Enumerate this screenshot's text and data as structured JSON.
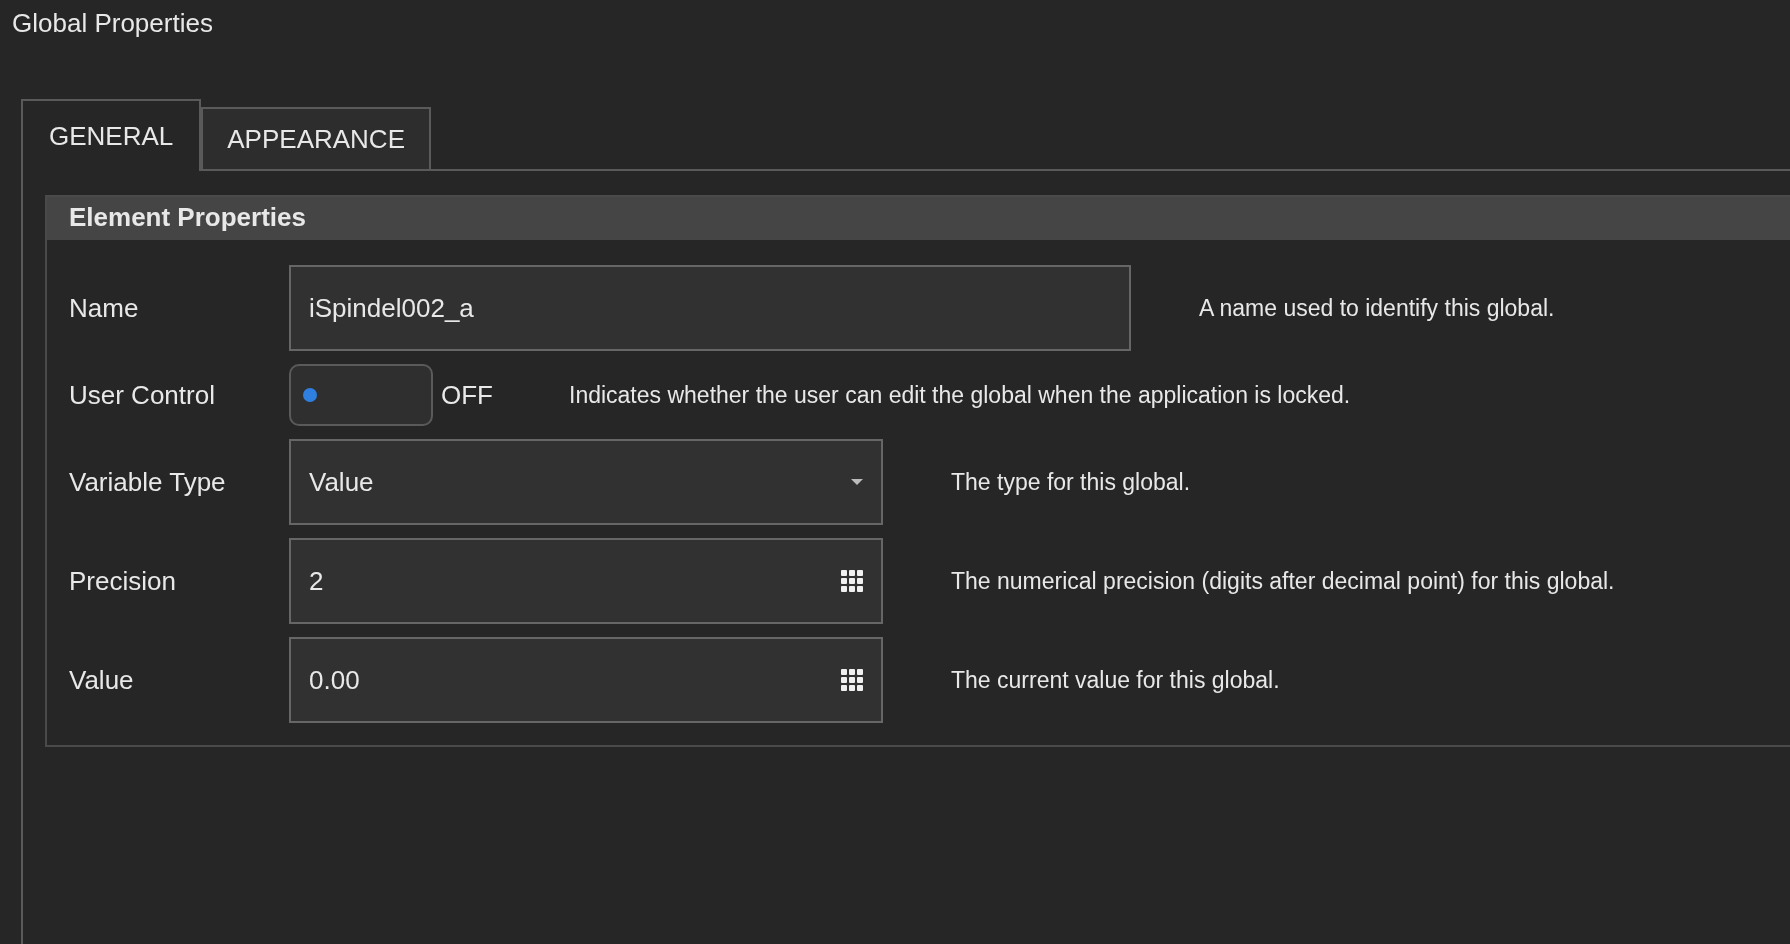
{
  "window": {
    "title": "Global Properties"
  },
  "tabs": [
    {
      "label": "GENERAL",
      "selected": true
    },
    {
      "label": "APPEARANCE",
      "selected": false
    }
  ],
  "section": {
    "title": "Element Properties",
    "fields": [
      {
        "kind": "text",
        "label": "Name",
        "value": "iSpindel002_a",
        "description": "A name used to identify this global."
      },
      {
        "kind": "toggle",
        "label": "User Control",
        "on": false,
        "state_text": "OFF",
        "description": "Indicates whether the user can edit the global when the application is locked."
      },
      {
        "kind": "dropdown",
        "label": "Variable Type",
        "value": "Value",
        "description": "The type for this global."
      },
      {
        "kind": "numeric",
        "label": "Precision",
        "value": "2",
        "description": "The numerical precision (digits after decimal point) for this global."
      },
      {
        "kind": "numeric",
        "label": "Value",
        "value": "0.00",
        "description": "The current value for this global."
      }
    ]
  }
}
